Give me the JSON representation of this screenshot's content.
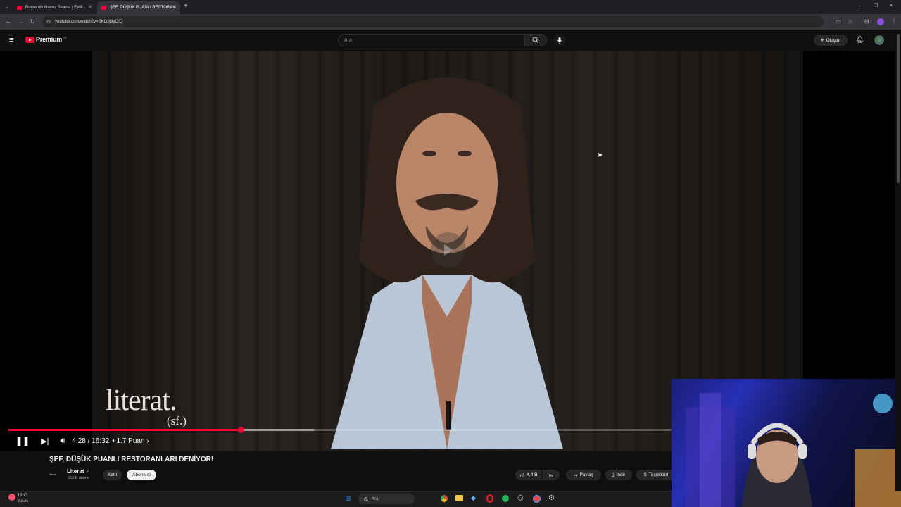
{
  "browser": {
    "tabs": [
      {
        "title": "Romantik Havuz Seansı | Evlili..."
      },
      {
        "title": "ŞEF, DÜŞÜK PUANLI RESTORAN..."
      }
    ],
    "url": "youtube.com/watch?v=SKbdjbtyOfQ"
  },
  "youtube": {
    "logo_text": "Premium",
    "logo_region": "TR",
    "search_placeholder": "Ara",
    "create_label": "Oluştur"
  },
  "video": {
    "watermark": "literat.",
    "watermark_sub": "(sf.)",
    "time_display": "4:28 / 16:32",
    "chapter": "• 1.7 Puan ›",
    "progress": 0.35,
    "buffered": 0.46
  },
  "meta": {
    "title": "ŞEF, DÜŞÜK PUANLI RESTORANLARI DENİYOR!",
    "channel_logo_text": "literat",
    "channel": "Literat",
    "subscribers": "553 B abone",
    "join_label": "Katıl",
    "subscribe_label": "Abone ol",
    "like_count": "4,4 B",
    "share_label": "Paylaş",
    "download_label": "İndir",
    "thanks_label": "Teşekkürl"
  },
  "taskbar": {
    "weather_temp": "12°C",
    "weather_desc": "Bulutlu",
    "search_label": "Ara"
  },
  "colors": {
    "accent": "#ff0033",
    "bg": "#0f0f0f",
    "chip": "#272727"
  }
}
